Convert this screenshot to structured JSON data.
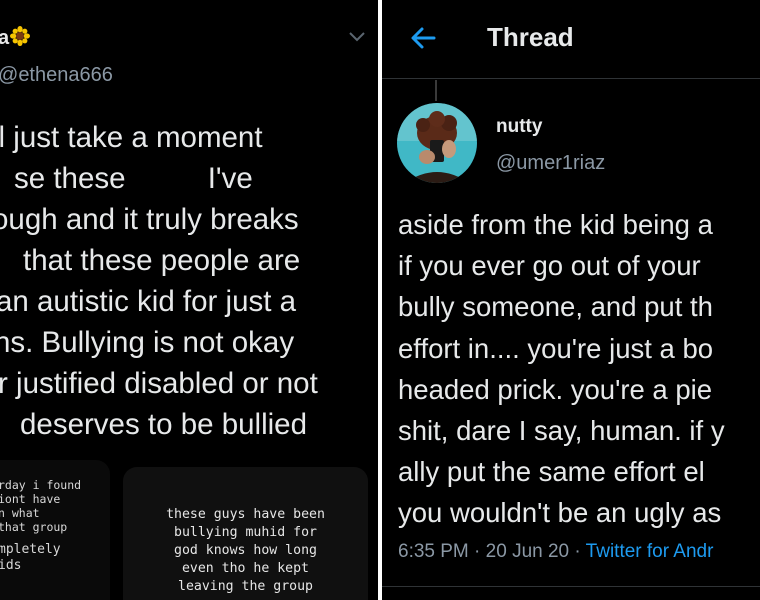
{
  "left_tweet": {
    "display_name": "a",
    "emoji": "sunflower",
    "handle": "ethena666",
    "lines": [
      "ll just take a moment",
      "se these",
      "I've",
      "ough and it truly breaks",
      "that these people are",
      "an autistic kid for just a",
      "ns. Bullying is not okay",
      "r justified disabled or not",
      "deserves to be bullied"
    ],
    "story_left_lines": [
      "rday i found",
      "iont have",
      "n what",
      "that group",
      "mpletely",
      "ids"
    ],
    "story_right_lines": [
      "these guys have been",
      "bullying muhid for",
      "god knows how long",
      "even tho he kept",
      "leaving the group"
    ]
  },
  "right_tweet": {
    "header_title": "Thread",
    "name": "nutty",
    "handle": "@umer1riaz",
    "lines": [
      "aside from the kid being a",
      "if you ever go out of your",
      "bully someone, and put th",
      "effort in.... you're just a bo",
      "headed prick. you're a pie",
      "shit, dare I say, human. if y",
      "ally put the same effort el",
      "you wouldn't be an ugly as"
    ],
    "time": "6:35 PM",
    "date": "20 Jun 20",
    "separator": "·",
    "source": "Twitter for Andr"
  },
  "colors": {
    "background": "#000000",
    "text": "#e7e9ea",
    "secondary": "#8b98a5",
    "accent": "#1d9bf0"
  },
  "icons": [
    "sunflower-icon",
    "chevron-down-icon",
    "back-arrow-icon"
  ]
}
